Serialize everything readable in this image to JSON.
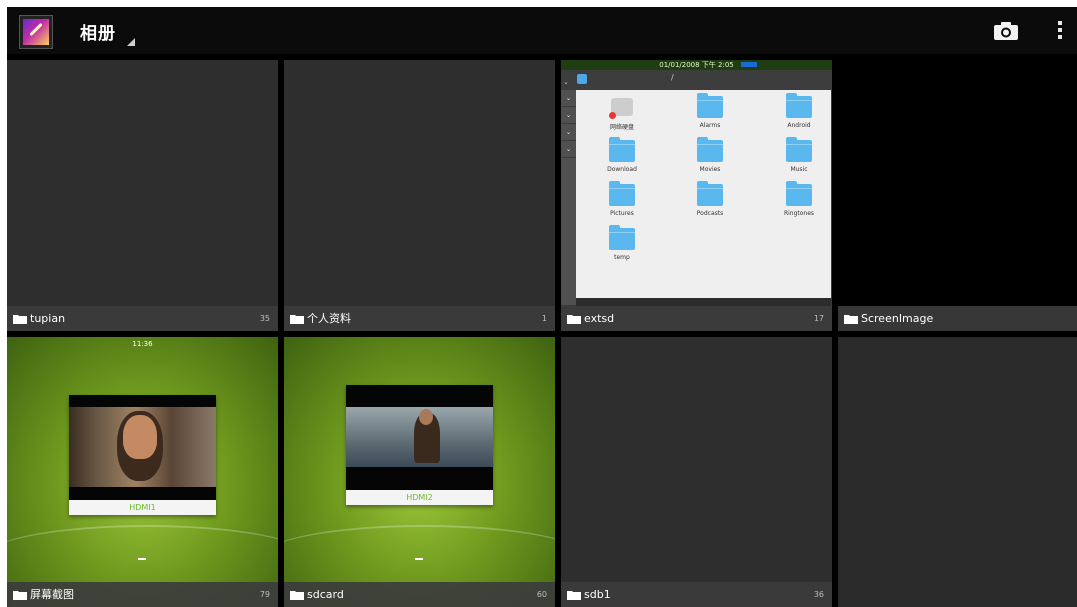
{
  "actionbar": {
    "title": "相册",
    "camera_icon": "camera-icon",
    "overflow_icon": "overflow-menu-icon"
  },
  "albums": [
    {
      "name": "tupian",
      "count": "35",
      "preview": "empty"
    },
    {
      "name": "个人资料",
      "count": "1",
      "preview": "empty"
    },
    {
      "name": "extsd",
      "count": "17",
      "preview": "file-manager-screenshot"
    },
    {
      "name": "ScreenImage",
      "count": "",
      "preview": "black"
    },
    {
      "name": "屏幕截图",
      "count": "79",
      "preview": "hdmi1-screenshot"
    },
    {
      "name": "sdcard",
      "count": "60",
      "preview": "hdmi2-screenshot"
    },
    {
      "name": "sdb1",
      "count": "36",
      "preview": "empty"
    }
  ],
  "extsd_preview": {
    "status_text": "01/01/2008 下午 2:05",
    "path": "/",
    "items": [
      "网络硬盘",
      "Alarms",
      "Android",
      "Download",
      "Movies",
      "Music",
      "Pictures",
      "Podcasts",
      "Ringtones",
      "temp"
    ]
  },
  "hdmi1_preview": {
    "time": "11:36",
    "caption": "HDMI1"
  },
  "hdmi2_preview": {
    "caption": "HDMI2"
  },
  "colors": {
    "actionbar_bg": "#0b0b0b",
    "tile_bg": "#2e2e2e",
    "label_bg": "#3c3c3c",
    "hdmi_caption": "#6db82e",
    "folder_blue": "#5ab8ee"
  }
}
